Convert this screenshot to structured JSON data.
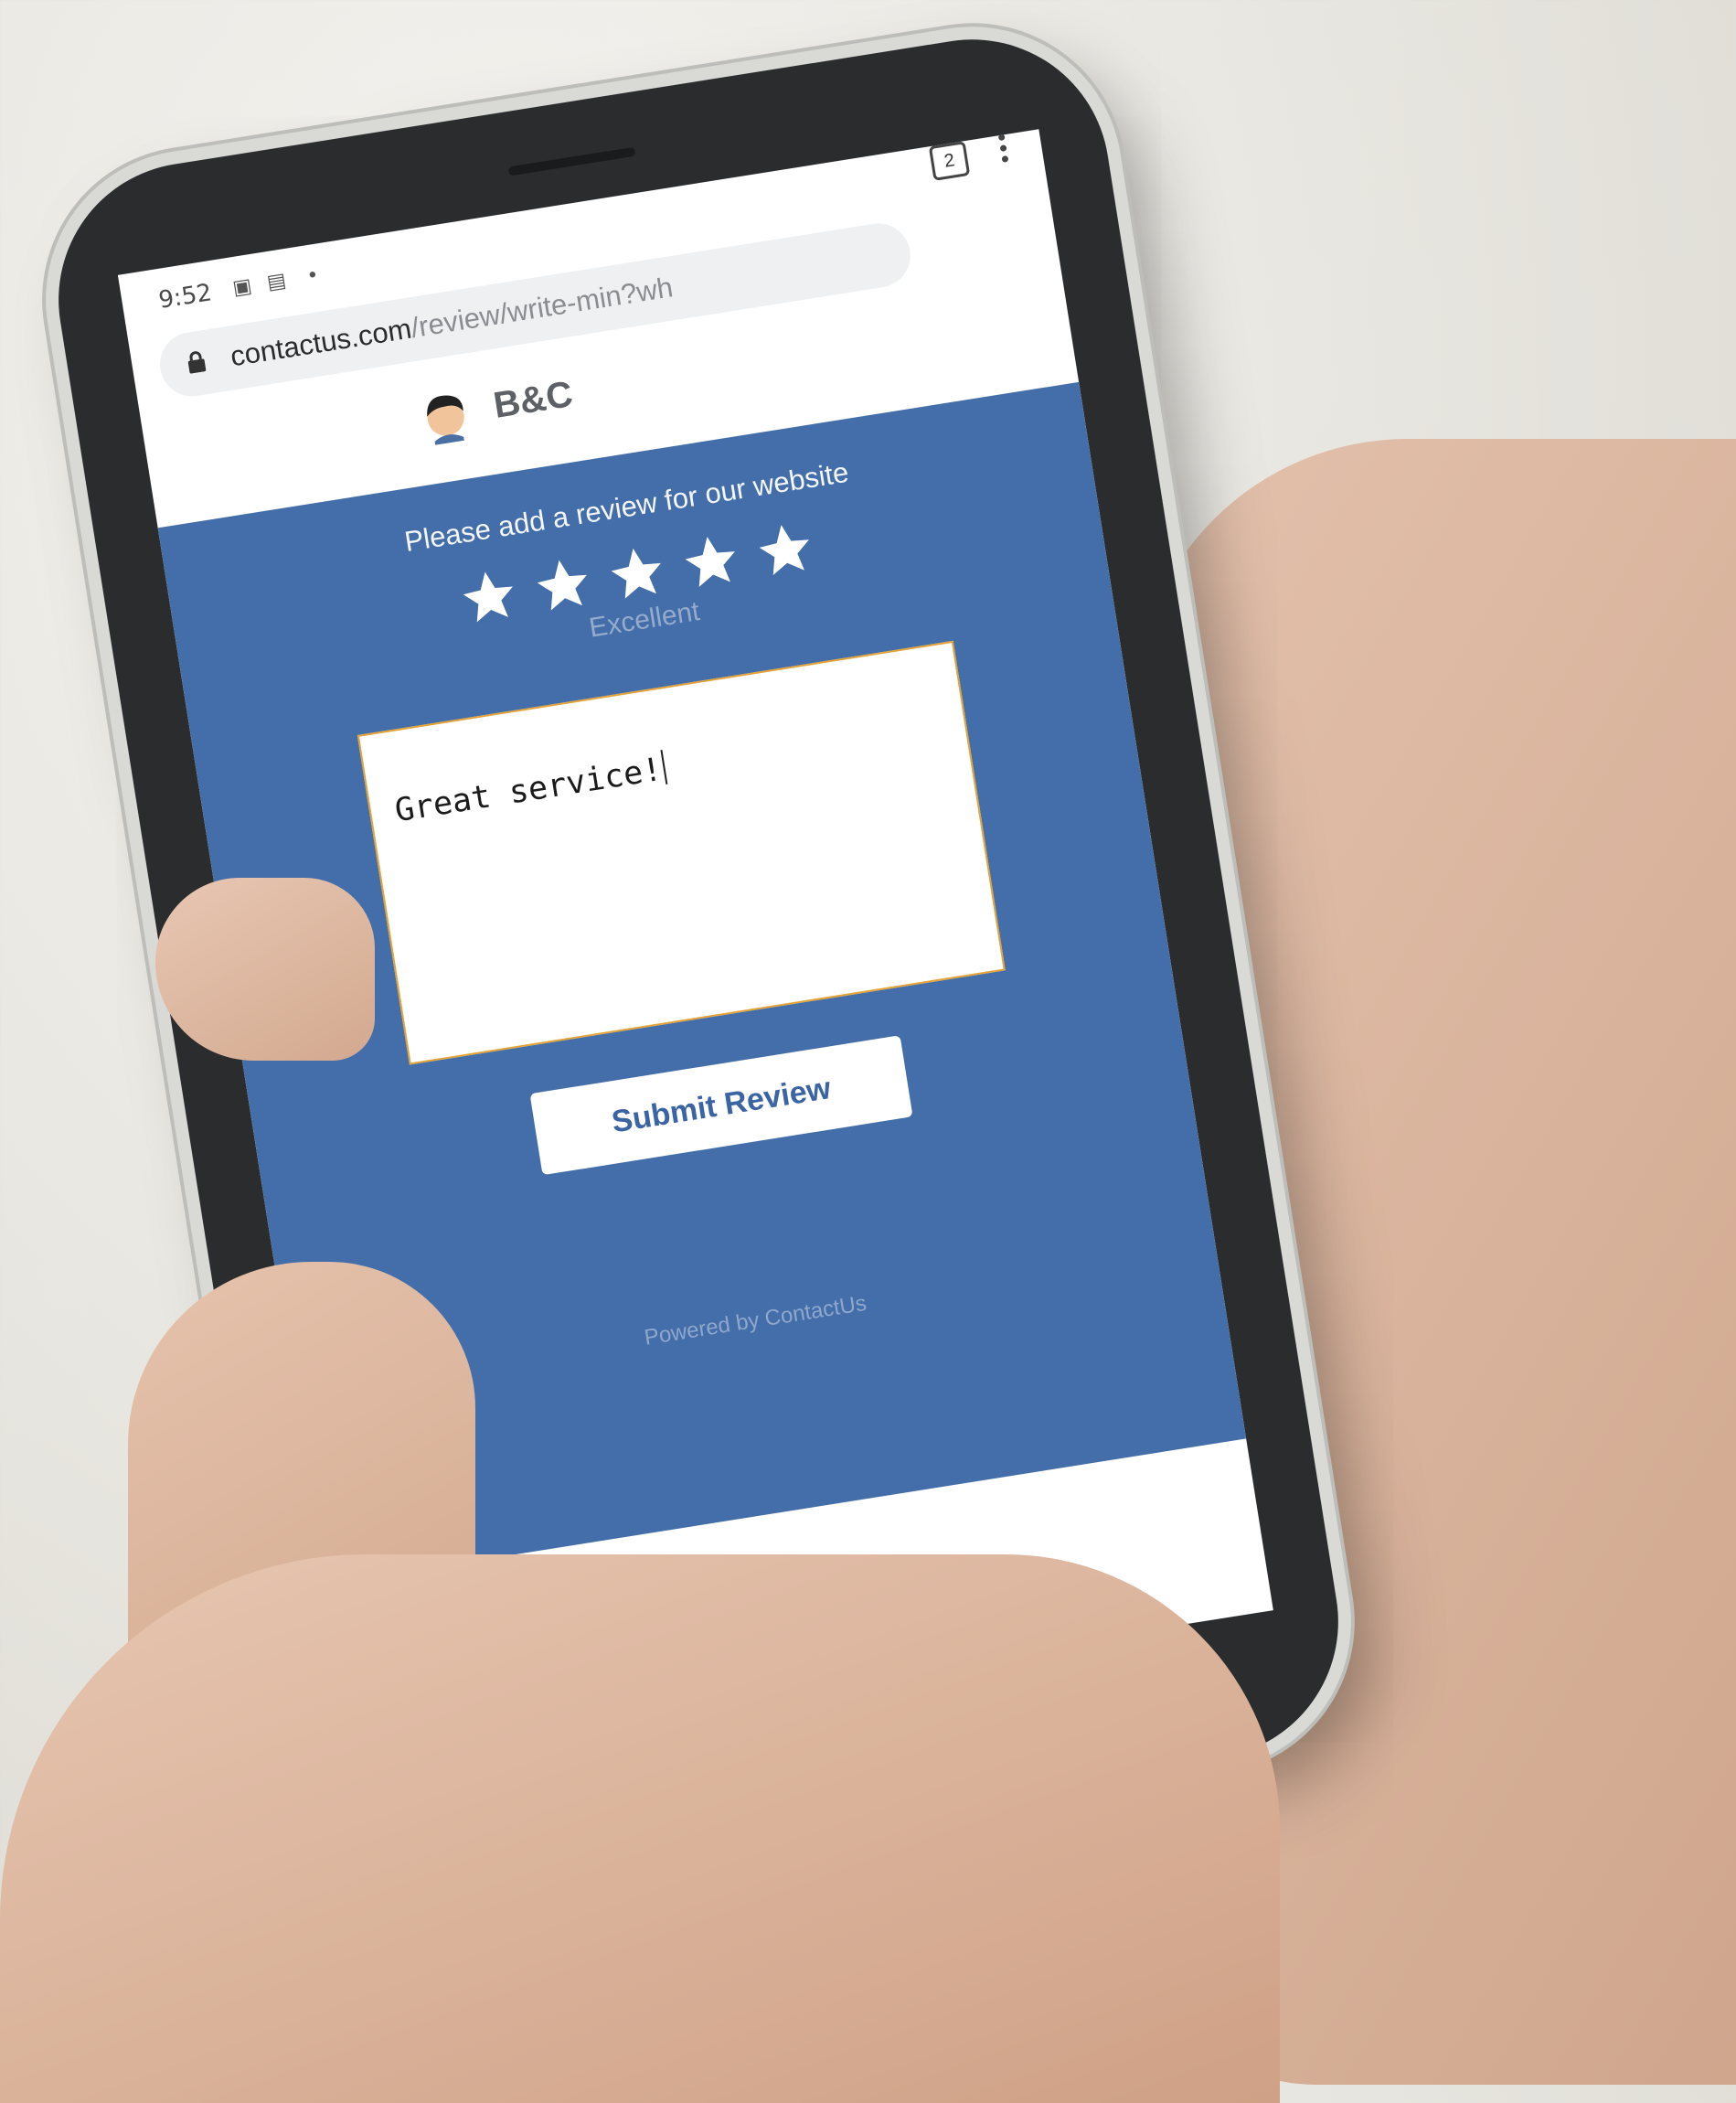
{
  "status_bar": {
    "time": "9:52",
    "left_icons": [
      "image-icon",
      "news-icon",
      "dot-icon"
    ],
    "right_icons": [
      "wifi-icon",
      "signal-icon",
      "battery-icon"
    ]
  },
  "browser": {
    "url_host": "contactus.com",
    "url_path": "/review/write-min?wh",
    "tab_count": "2",
    "icons": [
      "lock-icon",
      "tabs-icon",
      "more-vert-icon"
    ]
  },
  "site": {
    "brand": "B&C",
    "avatar_icon": "avatar-icon"
  },
  "review": {
    "prompt": "Please add a review for our website",
    "rating": 5,
    "rating_max": 5,
    "rating_label": "Excellent",
    "text": "Great service!",
    "submit_label": "Submit Review",
    "powered_by": "Powered by ContactUs"
  },
  "nav": {
    "back_symbol": "<",
    "icons": [
      "back-icon",
      "home-pill-icon"
    ]
  },
  "colors": {
    "page_blue": "#436eaa",
    "field_border": "#e4a336",
    "button_text": "#3a64a3"
  }
}
